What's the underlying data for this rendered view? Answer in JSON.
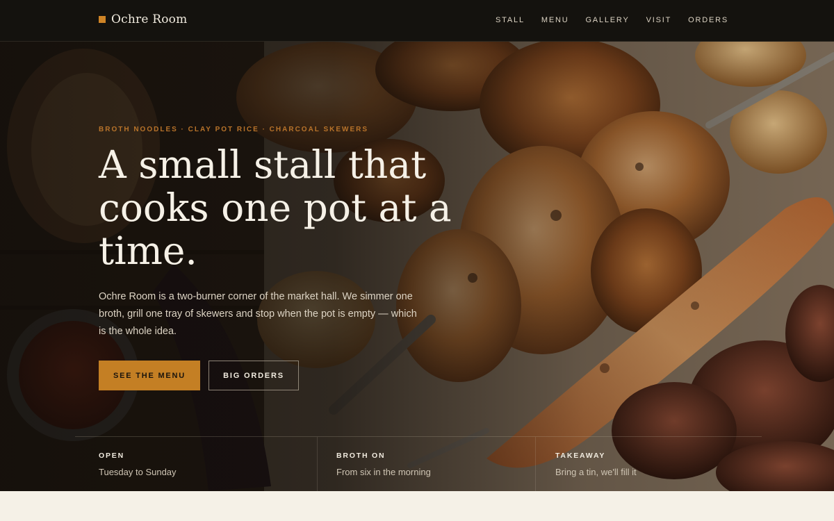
{
  "brand": {
    "name": "Ochre Room"
  },
  "nav": {
    "items": [
      "STALL",
      "MENU",
      "GALLERY",
      "VISIT",
      "ORDERS"
    ]
  },
  "hero": {
    "eyebrow": "BROTH NOODLES · CLAY POT RICE · CHARCOAL SKEWERS",
    "headline": "A small stall that cooks one pot at a time.",
    "lede": "Ochre Room is a two-burner corner of the market hall. We simmer one broth, grill one tray of skewers and stop when the pot is empty — which is the whole idea.",
    "primary_cta": "SEE THE MENU",
    "secondary_cta": "BIG ORDERS"
  },
  "info": [
    {
      "title": "OPEN",
      "text": "Tuesday to Sunday"
    },
    {
      "title": "BROTH ON",
      "text": "From six in the morning"
    },
    {
      "title": "TAKEAWAY",
      "text": "Bring a tin, we'll fill it"
    }
  ],
  "colors": {
    "accent": "#c47f24",
    "topbar": "#14120e",
    "page": "#f5f1e7"
  }
}
